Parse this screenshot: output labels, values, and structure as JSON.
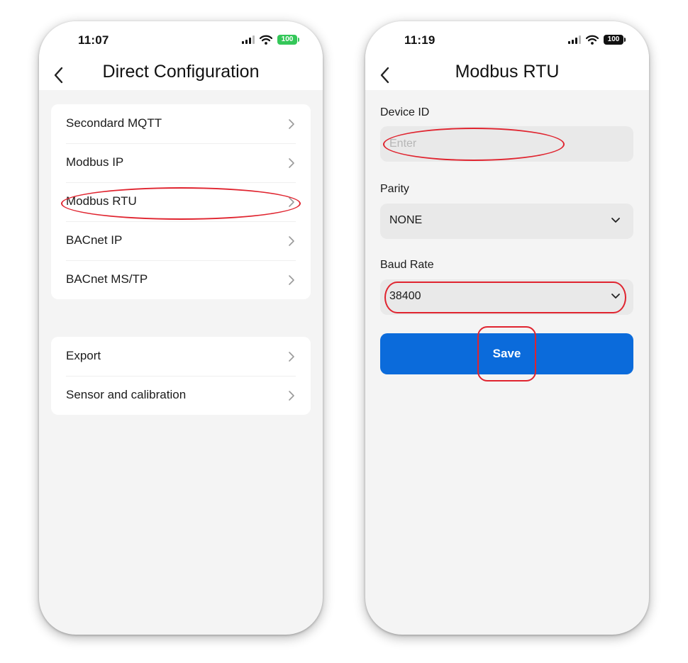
{
  "left_screen": {
    "status_bar": {
      "time": "11:07",
      "battery": "100"
    },
    "title": "Direct Configuration",
    "group_one": [
      {
        "label": "Secondard MQTT"
      },
      {
        "label": "Modbus IP"
      },
      {
        "label": "Modbus RTU"
      },
      {
        "label": "BACnet IP"
      },
      {
        "label": "BACnet MS/TP"
      }
    ],
    "group_two": [
      {
        "label": "Export"
      },
      {
        "label": "Sensor and calibration"
      }
    ]
  },
  "right_screen": {
    "status_bar": {
      "time": "11:19",
      "battery": "100"
    },
    "title": "Modbus RTU",
    "device_id": {
      "label": "Device ID",
      "value": "",
      "placeholder": "Enter"
    },
    "parity": {
      "label": "Parity",
      "value": "NONE"
    },
    "baud_rate": {
      "label": "Baud Rate",
      "value": "38400"
    },
    "save_label": "Save"
  },
  "colors": {
    "accent": "#0b6bdb",
    "highlight": "#e0242f",
    "battery_green": "#34c759",
    "background": "#f4f4f4"
  },
  "icons": [
    "back-icon",
    "chevron-right-icon",
    "chevron-down-icon",
    "signal-icon",
    "wifi-icon",
    "battery-icon"
  ]
}
